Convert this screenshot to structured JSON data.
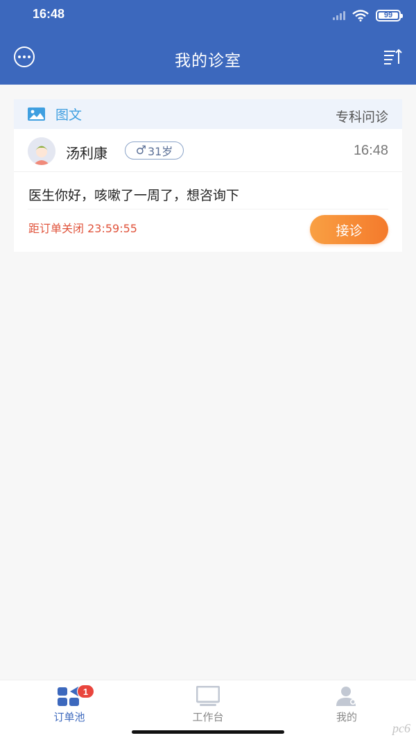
{
  "status_bar": {
    "time": "16:48",
    "battery": "99"
  },
  "header": {
    "title": "我的诊室",
    "left_icon": "more-circle-icon",
    "right_icon": "sort-list-icon"
  },
  "card": {
    "type_label": "图文",
    "type_icon": "image-icon",
    "department": "专科问诊",
    "patient": {
      "name": "汤利康",
      "gender_symbol": "♂",
      "age": "31岁",
      "time": "16:48"
    },
    "message": "医生你好，咳嗽了一周了，想咨询下",
    "countdown": "距订单关闭 23:59:55",
    "accept_label": "接诊"
  },
  "tabs": [
    {
      "label": "订单池",
      "icon": "order-pool-icon",
      "badge": "1",
      "active": true
    },
    {
      "label": "工作台",
      "icon": "monitor-icon",
      "active": false
    },
    {
      "label": "我的",
      "icon": "user-icon",
      "active": false
    }
  ],
  "colors": {
    "primary": "#3c68bd",
    "accent": "#f47a2c",
    "alert": "#e0523a"
  },
  "watermark": "pc6"
}
